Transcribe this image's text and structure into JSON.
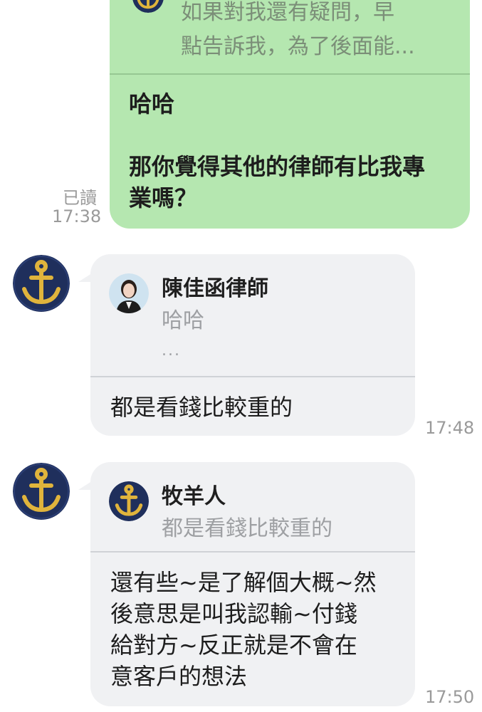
{
  "outgoing": {
    "reply_preview_text": "如果對我還有疑問，早\n點告訴我，為了後面能...",
    "message": "哈哈\n\n那你覺得其他的律師有比我專\n業嗎？",
    "read_label": "已讀",
    "time": "17:38"
  },
  "incoming": [
    {
      "reply_name": "陳佳函律師",
      "reply_quote": "哈哈",
      "reply_ellipsis": "...",
      "message": "都是看錢比較重的",
      "time": "17:48"
    },
    {
      "reply_name": "牧羊人",
      "reply_quote": "都是看錢比較重的",
      "message": "還有些~是了解個大概~然\n後意思是叫我認輸~付錢\n給對方~反正就是不會在\n意客戶的想法",
      "time": "17:50"
    }
  ],
  "colors": {
    "outgoing_bubble": "#b5e7b0",
    "incoming_bubble": "#f0f1f3",
    "avatar_bg": "#1f2f5c",
    "anchor_gold": "#e0b43c"
  },
  "icons": {
    "sender_avatar": "anchor-icon",
    "lawyer_avatar": "person-photo"
  }
}
